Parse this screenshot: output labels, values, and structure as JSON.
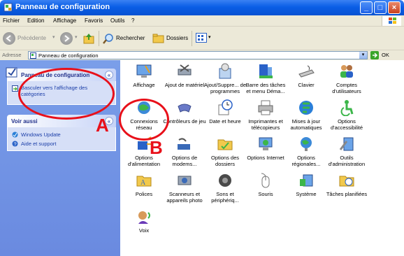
{
  "window": {
    "title": "Panneau de configuration"
  },
  "menu": [
    "Fichier",
    "Edition",
    "Affichage",
    "Favoris",
    "Outils",
    "?"
  ],
  "toolbar": {
    "back": "Précédente",
    "search": "Rechercher",
    "folders": "Dossiers"
  },
  "address": {
    "label": "Adresse",
    "value": "Panneau de configuration",
    "go": "OK"
  },
  "leftpane": {
    "panel1_title": "Panneau de configuration",
    "panel1_link": "Basculer vers l'affichage des catégories",
    "panel2_title": "Voir aussi",
    "panel2_links": [
      "Windows Update",
      "Aide et support"
    ]
  },
  "items": [
    "Affichage",
    "Ajout de matériel",
    "Ajout/Suppre... de programmes",
    "Barre des tâches et menu Déma...",
    "Clavier",
    "Comptes d'utilisateurs",
    "Connexions réseau",
    "Contrôleurs de jeu",
    "Date et heure",
    "Imprimantes et télécopieurs",
    "Mises à jour automatiques",
    "Options d'accessibilité",
    "Options d'alimentation",
    "Options de modems...",
    "Options des dossiers",
    "Options Internet",
    "Options régionales...",
    "Outils d'administration",
    "Polices",
    "Scanneurs et appareils photo",
    "Sons et périphériq...",
    "Souris",
    "Système",
    "Tâches planifiées",
    "Voix"
  ],
  "annotations": {
    "a": "A",
    "b": "B"
  }
}
